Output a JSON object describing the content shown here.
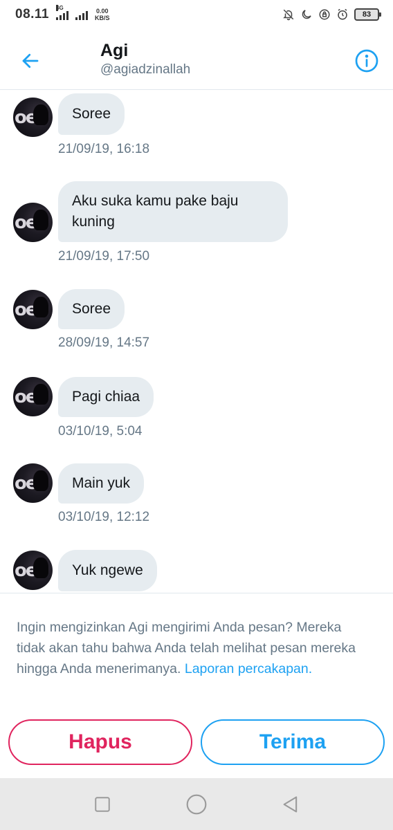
{
  "status_bar": {
    "time": "08.11",
    "network_type": "4G",
    "net_speed_value": "0.00",
    "net_speed_unit": "KB/S",
    "battery": "83",
    "icons": [
      "bell-off-icon",
      "moon-icon",
      "lock-rotation-icon",
      "alarm-icon"
    ]
  },
  "header": {
    "name": "Agi",
    "handle": "@agiadzinallah",
    "accent_color": "#1da1f2"
  },
  "messages": [
    {
      "text": "Soree",
      "time": "21/09/19, 16:18"
    },
    {
      "text": "Aku suka kamu pake baju kuning",
      "time": "21/09/19, 17:50"
    },
    {
      "text": "Soree",
      "time": "28/09/19, 14:57"
    },
    {
      "text": "Pagi chiaa",
      "time": "03/10/19, 5:04"
    },
    {
      "text": "Main yuk",
      "time": "03/10/19, 12:12"
    },
    {
      "text": "Yuk ngewe",
      "time": ""
    }
  ],
  "request": {
    "text": "Ingin mengizinkan Agi mengirimi Anda pesan? Mereka tidak akan tahu bahwa Anda telah melihat pesan mereka hingga Anda menerimanya.",
    "link": "Laporan percakapan.",
    "delete_label": "Hapus",
    "accept_label": "Terima",
    "delete_color": "#e0245e",
    "accept_color": "#1da1f2"
  },
  "nav": {
    "icons": [
      "recent-apps-icon",
      "home-icon",
      "back-nav-icon"
    ]
  }
}
